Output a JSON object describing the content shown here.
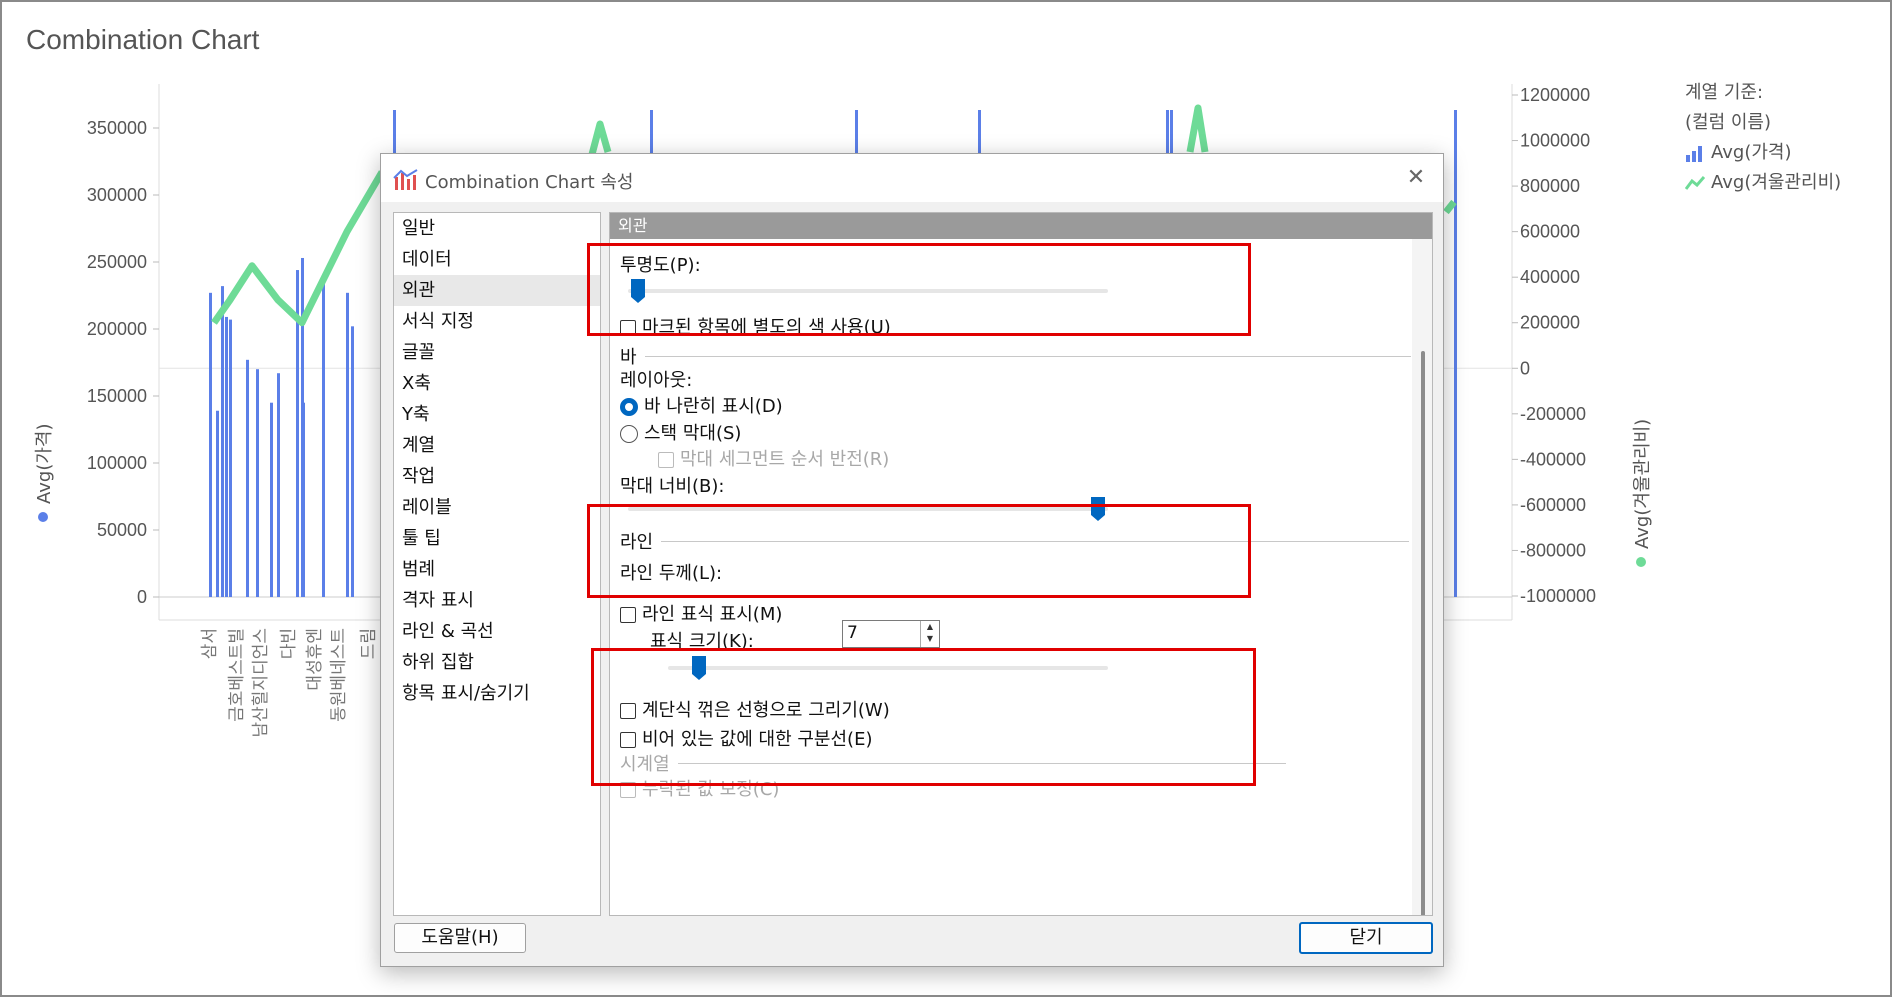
{
  "page": {
    "title": "Combination Chart"
  },
  "chart_data": {
    "type": "bar",
    "combination": true,
    "title": "Combination Chart",
    "ylabel": "Avg(가격)",
    "y2label": "Avg(겨울관리비)",
    "ylim": [
      0,
      350000
    ],
    "y2lim": [
      -1000000,
      1200000
    ],
    "y_ticks": [
      "350000",
      "300000",
      "250000",
      "200000",
      "150000",
      "100000",
      "50000",
      "0"
    ],
    "y2_ticks": [
      "1200000",
      "1000000",
      "800000",
      "600000",
      "400000",
      "200000",
      "0",
      "-200000",
      "-400000",
      "-600000",
      "-800000",
      "-1000000"
    ],
    "visible_categories": [
      "삼서",
      "금호베스트빌",
      "남산힐지디언스",
      "다빈",
      "대성휴엔",
      "동원베네스트",
      "드림"
    ],
    "series": [
      {
        "name": "Avg(가격)",
        "kind": "bar",
        "values": [
          227000,
          139000,
          232000,
          209000,
          207000,
          177000,
          170000,
          145000,
          167000,
          253000,
          244000,
          145000,
          240000,
          227000,
          202000
        ]
      },
      {
        "name": "Avg(겨울관리비)",
        "kind": "line",
        "values": [
          200000,
          300000,
          450000,
          300000,
          200000,
          600000
        ]
      }
    ],
    "legend_position": "top-right",
    "legend_title": [
      "계열 기준:",
      "(컬럼 이름)"
    ],
    "colors": {
      "bar": "#5b7fe8",
      "line": "#6edb97"
    }
  },
  "dialog": {
    "title": "Combination Chart 속성",
    "close_symbol": "✕",
    "nav_items": [
      "일반",
      "데이터",
      "외관",
      "서식 지정",
      "글꼴",
      "X축",
      "Y축",
      "계열",
      "작업",
      "레이블",
      "툴 팁",
      "범례",
      "격자 표시",
      "라인 & 곡선",
      "하위 집합",
      "항목 표시/숨기기"
    ],
    "selected_nav": "외관",
    "section_header": "외관",
    "transparency_label": "투명도(P):",
    "transparency_level": 0.02,
    "marked_color_label": "마크된 항목에 별도의 색 사용(U)",
    "bar_section": "바",
    "layout_label": "레이아웃:",
    "side_by_side_label": "바 나란히 표시(D)",
    "stacked_label": "스택 막대(S)",
    "reverse_segment_label": "막대 세그먼트 순서 반전(R)",
    "bar_width_label": "막대 너비(B):",
    "bar_width_level": 0.98,
    "line_section": "라인",
    "line_width_label": "라인 두께(L):",
    "line_width_value": "7",
    "show_markers_label": "라인 표식 표시(M)",
    "marker_size_label": "표식 크기(K):",
    "marker_size_level": 0.07,
    "step_label": "계단식 꺾은 선형으로 그리기(W)",
    "gap_label": "비어 있는 값에 대한 구분선(E)",
    "timeseries_section": "시계열",
    "missing_label": "누락된 값 보정(C)",
    "help_button": "도움말(H)",
    "close_button": "닫기"
  }
}
